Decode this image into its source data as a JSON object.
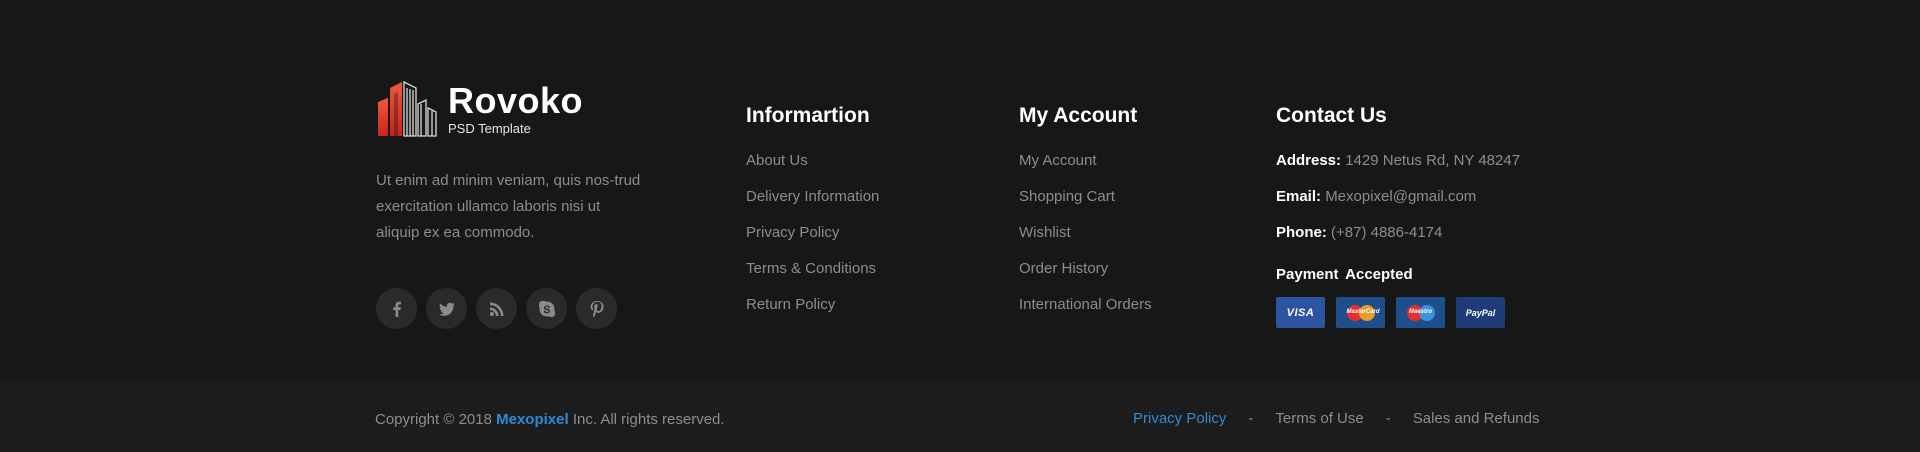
{
  "brand": {
    "name": "Rovoko",
    "tagline": "PSD Template",
    "description": "Ut enim ad minim veniam, quis nos-trud exercitation ullamco laboris nisi ut aliquip ex ea commodo.",
    "social_icons": [
      "facebook-icon",
      "twitter-icon",
      "rss-icon",
      "skype-icon",
      "pinterest-icon"
    ]
  },
  "information": {
    "title": "Informartion",
    "links": [
      "About Us",
      "Delivery Information",
      "Privacy Policy",
      "Terms & Conditions",
      "Return Policy"
    ]
  },
  "account": {
    "title": "My Account",
    "links": [
      "My Account",
      "Shopping Cart",
      "Wishlist",
      "Order History",
      "International Orders"
    ]
  },
  "contact": {
    "title": "Contact Us",
    "address_label": "Address:",
    "address": "1429 Netus Rd, NY 48247",
    "email_label": "Email:",
    "email": "Mexopixel@gmail.com",
    "phone_label": "Phone:",
    "phone": "(+87) 4886-4174",
    "payment_title": "Payment  Accepted",
    "payment_methods": [
      "VISA",
      "MasterCard",
      "Maestro",
      "PayPal"
    ]
  },
  "bottom": {
    "copyright_prefix": "Copyright © 2018",
    "company": "Mexopixel",
    "copyright_suffix": "Inc. All rights reserved.",
    "links": [
      "Privacy Policy",
      "Terms of Use",
      "Sales and Refunds"
    ],
    "separator": "-"
  },
  "colors": {
    "background": "#171717",
    "bottom_bar": "#1c1c1c",
    "accent": "#2b8bd6",
    "logo_red": "#e8402f"
  }
}
